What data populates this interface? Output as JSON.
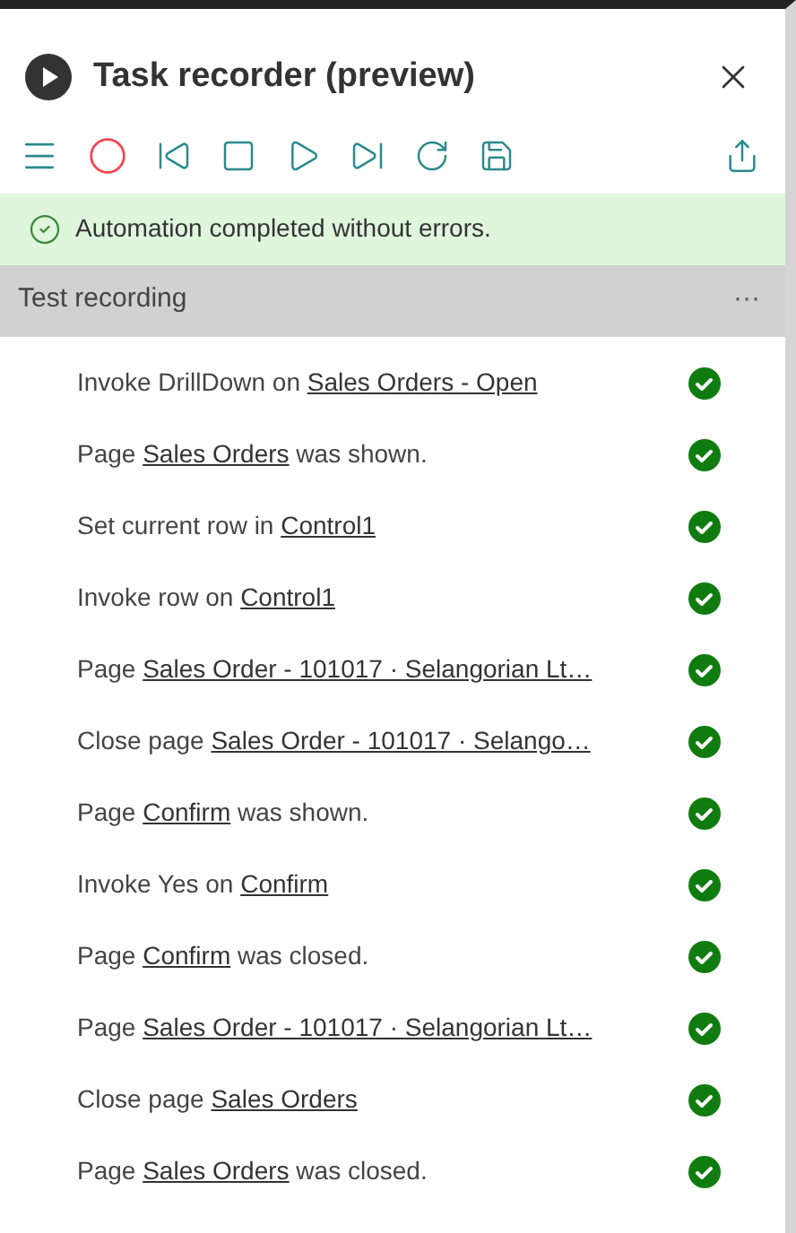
{
  "window": {
    "title": "Task recorder (preview)"
  },
  "toolbar": {
    "recording": true
  },
  "banner": {
    "text": "Automation completed without errors.",
    "success": true
  },
  "section": {
    "title": "Test recording",
    "more": "···"
  },
  "steps": [
    {
      "prefix": "Invoke DrillDown on ",
      "link": "Sales Orders - Open",
      "passed": true
    },
    {
      "prefix": "Page ",
      "link": "Sales Orders",
      "suffix": " was shown.",
      "passed": true
    },
    {
      "prefix": "Set current row in ",
      "link": "Control1",
      "passed": true
    },
    {
      "prefix": "Invoke row on ",
      "link": "Control1",
      "passed": true
    },
    {
      "prefix": "Page ",
      "link": "Sales Order - 101017 · Selangorian Lt…",
      "passed": true
    },
    {
      "prefix": "Close page ",
      "link": "Sales Order - 101017 · Selango…",
      "passed": true
    },
    {
      "prefix": "Page ",
      "link": "Confirm",
      "suffix": " was shown.",
      "passed": true
    },
    {
      "prefix": "Invoke Yes on ",
      "link": "Confirm",
      "passed": true
    },
    {
      "prefix": "Page ",
      "link": "Confirm",
      "suffix": " was closed.",
      "passed": true
    },
    {
      "prefix": "Page ",
      "link": "Sales Order - 101017 · Selangorian Lt…",
      "passed": true
    },
    {
      "prefix": "Close page ",
      "link": "Sales Orders",
      "passed": true
    },
    {
      "prefix": "Page ",
      "link": "Sales Orders",
      "suffix": " was closed.",
      "passed": true
    }
  ]
}
